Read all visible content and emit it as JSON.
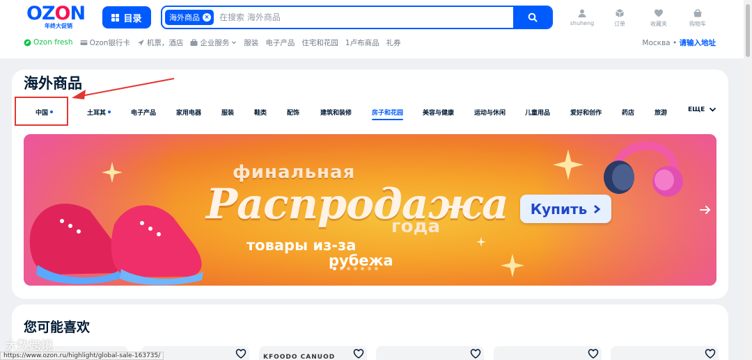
{
  "header": {
    "logo_text": "OZON",
    "logo_sub": "年终大促销",
    "catalog_label": "目录",
    "search_chip": "海外商品",
    "search_placeholder": "在搜索 海外商品",
    "actions": [
      {
        "label": "shuheng",
        "icon": "user-icon"
      },
      {
        "label": "订单",
        "icon": "box-icon"
      },
      {
        "label": "收藏夹",
        "icon": "heart-icon"
      },
      {
        "label": "购物车",
        "icon": "cart-icon"
      }
    ]
  },
  "subnav": {
    "items": [
      "Ozon fresh",
      "Ozon银行卡",
      "机票，酒店",
      "企业服务",
      "服装",
      "电子产品",
      "住宅和花园",
      "1卢布商品",
      "礼券"
    ],
    "region_city": "Москва",
    "region_link": "请输入地址"
  },
  "main": {
    "title": "海外商品",
    "tabs": [
      "中国",
      "土耳其",
      "电子产品",
      "家用电器",
      "服装",
      "鞋类",
      "配饰",
      "建筑和装修",
      "房子和花园",
      "美容与健康",
      "运动与休闲",
      "儿童用品",
      "爱好和创作",
      "药店",
      "旅游",
      "ЕЩЕ"
    ],
    "active_tab": "房子和花园",
    "banner": {
      "line1": "финальная",
      "line2": "Распродажа",
      "line3": "года",
      "line4": "товары из-за",
      "line5": "рубежа",
      "button": "Купить"
    }
  },
  "recommendations": {
    "title": "您可能喜欢",
    "card_text": "KFOODO CANUOD"
  },
  "status_url": "https://www.ozon.ru/highlight/global-sale-163735/",
  "watermark": "大数跨境",
  "colors": {
    "brand_blue": "#005bff",
    "brand_pink": "#f91155",
    "fresh_green": "#10c44c",
    "annotation_red": "#e3342f"
  }
}
